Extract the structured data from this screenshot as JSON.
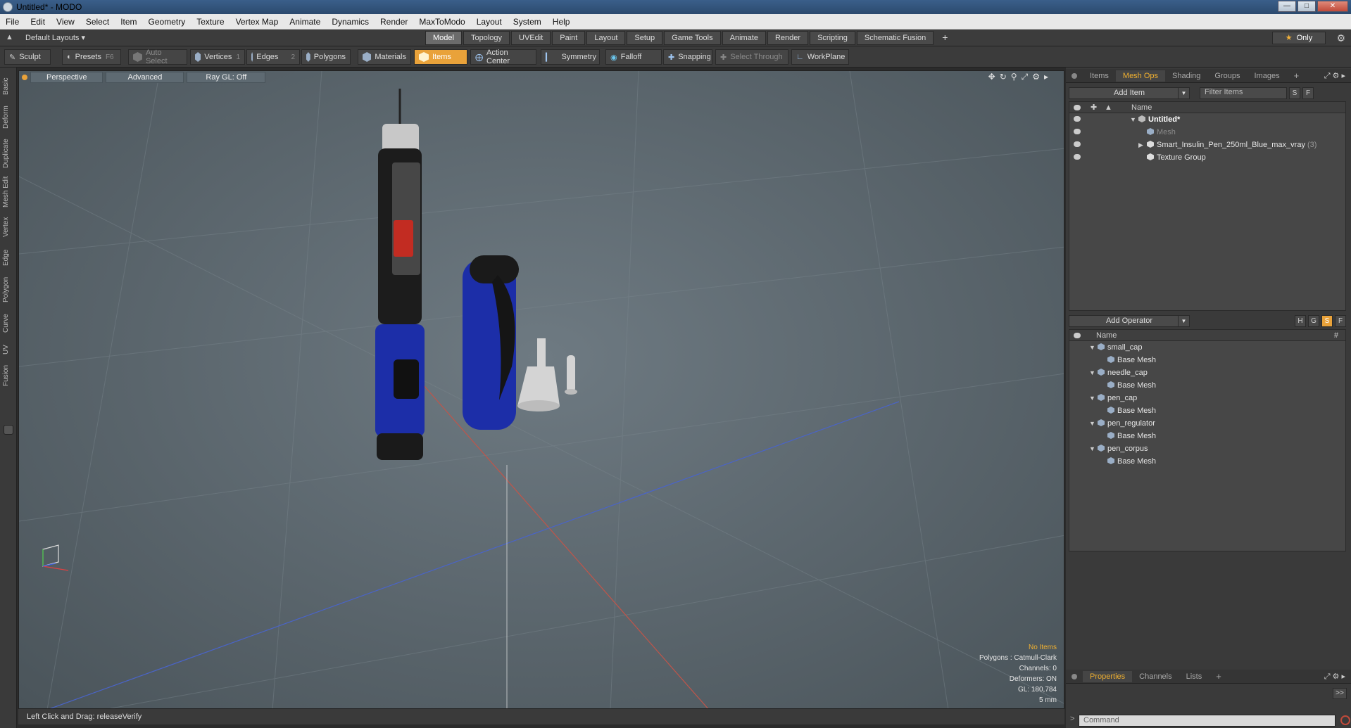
{
  "window": {
    "title": "Untitled* - MODO"
  },
  "menu": [
    "File",
    "Edit",
    "View",
    "Select",
    "Item",
    "Geometry",
    "Texture",
    "Vertex Map",
    "Animate",
    "Dynamics",
    "Render",
    "MaxToModo",
    "Layout",
    "System",
    "Help"
  ],
  "layout_bar": {
    "layouts_label": "Default Layouts ▾",
    "tabs": [
      "Model",
      "Topology",
      "UVEdit",
      "Paint",
      "Layout",
      "Setup",
      "Game Tools",
      "Animate",
      "Render",
      "Scripting",
      "Schematic Fusion"
    ],
    "active_tab": "Model",
    "only_label": "Only"
  },
  "toolbar": {
    "sculpt": "Sculpt",
    "presets": "Presets",
    "presets_key": "F6",
    "auto_select": "Auto Select",
    "vertices": "Vertices",
    "vertices_key": "1",
    "edges": "Edges",
    "edges_key": "2",
    "polygons": "Polygons",
    "materials": "Materials",
    "items": "Items",
    "action_center": "Action Center",
    "symmetry": "Symmetry",
    "falloff": "Falloff",
    "snapping": "Snapping",
    "select_through": "Select Through",
    "workplane": "WorkPlane"
  },
  "left_tabs": [
    "Basic",
    "Deform",
    "Duplicate",
    "Mesh Edit",
    "Vertex",
    "Edge",
    "Polygon",
    "Curve",
    "UV",
    "Fusion"
  ],
  "viewport": {
    "view_mode": "Perspective",
    "advanced": "Advanced",
    "raygl": "Ray GL: Off",
    "info": {
      "no_items": "No Items",
      "polygons": "Polygons : Catmull-Clark",
      "channels": "Channels: 0",
      "deformers": "Deformers: ON",
      "gl": "GL: 180,784",
      "scale": "5 mm"
    }
  },
  "status": {
    "text": "Left Click and Drag:   releaseVerify"
  },
  "items_panel": {
    "tabs": [
      "Items",
      "Mesh Ops",
      "Shading",
      "Groups",
      "Images"
    ],
    "active_tab": "Mesh Ops",
    "add_item": "Add Item",
    "filter_placeholder": "Filter Items",
    "btn_s": "S",
    "btn_f": "F",
    "header_name": "Name",
    "rows": [
      {
        "label": "Untitled*",
        "indent": 0,
        "toggle": "▼"
      },
      {
        "label": "Mesh",
        "indent": 1,
        "toggle": ""
      },
      {
        "label": "Smart_Insulin_Pen_250ml_Blue_max_vray",
        "count": "(3)",
        "indent": 1,
        "toggle": "▶"
      },
      {
        "label": "Texture Group",
        "indent": 1,
        "toggle": ""
      }
    ]
  },
  "operators_panel": {
    "add_operator": "Add Operator",
    "btn_h": "H",
    "btn_g": "G",
    "btn_s": "S",
    "btn_f": "F",
    "header_name": "Name",
    "header_hash": "#",
    "rows": [
      {
        "label": "small_cap",
        "level": 0
      },
      {
        "label": "Base Mesh",
        "level": 1
      },
      {
        "label": "needle_cap",
        "level": 0
      },
      {
        "label": "Base Mesh",
        "level": 1
      },
      {
        "label": "pen_cap",
        "level": 0
      },
      {
        "label": "Base Mesh",
        "level": 1
      },
      {
        "label": "pen_regulator",
        "level": 0
      },
      {
        "label": "Base Mesh",
        "level": 1
      },
      {
        "label": "pen_corpus",
        "level": 0
      },
      {
        "label": "Base Mesh",
        "level": 1
      }
    ]
  },
  "bottom_panel": {
    "tabs": [
      "Properties",
      "Channels",
      "Lists"
    ],
    "active_tab": "Properties",
    "command_placeholder": "Command"
  }
}
